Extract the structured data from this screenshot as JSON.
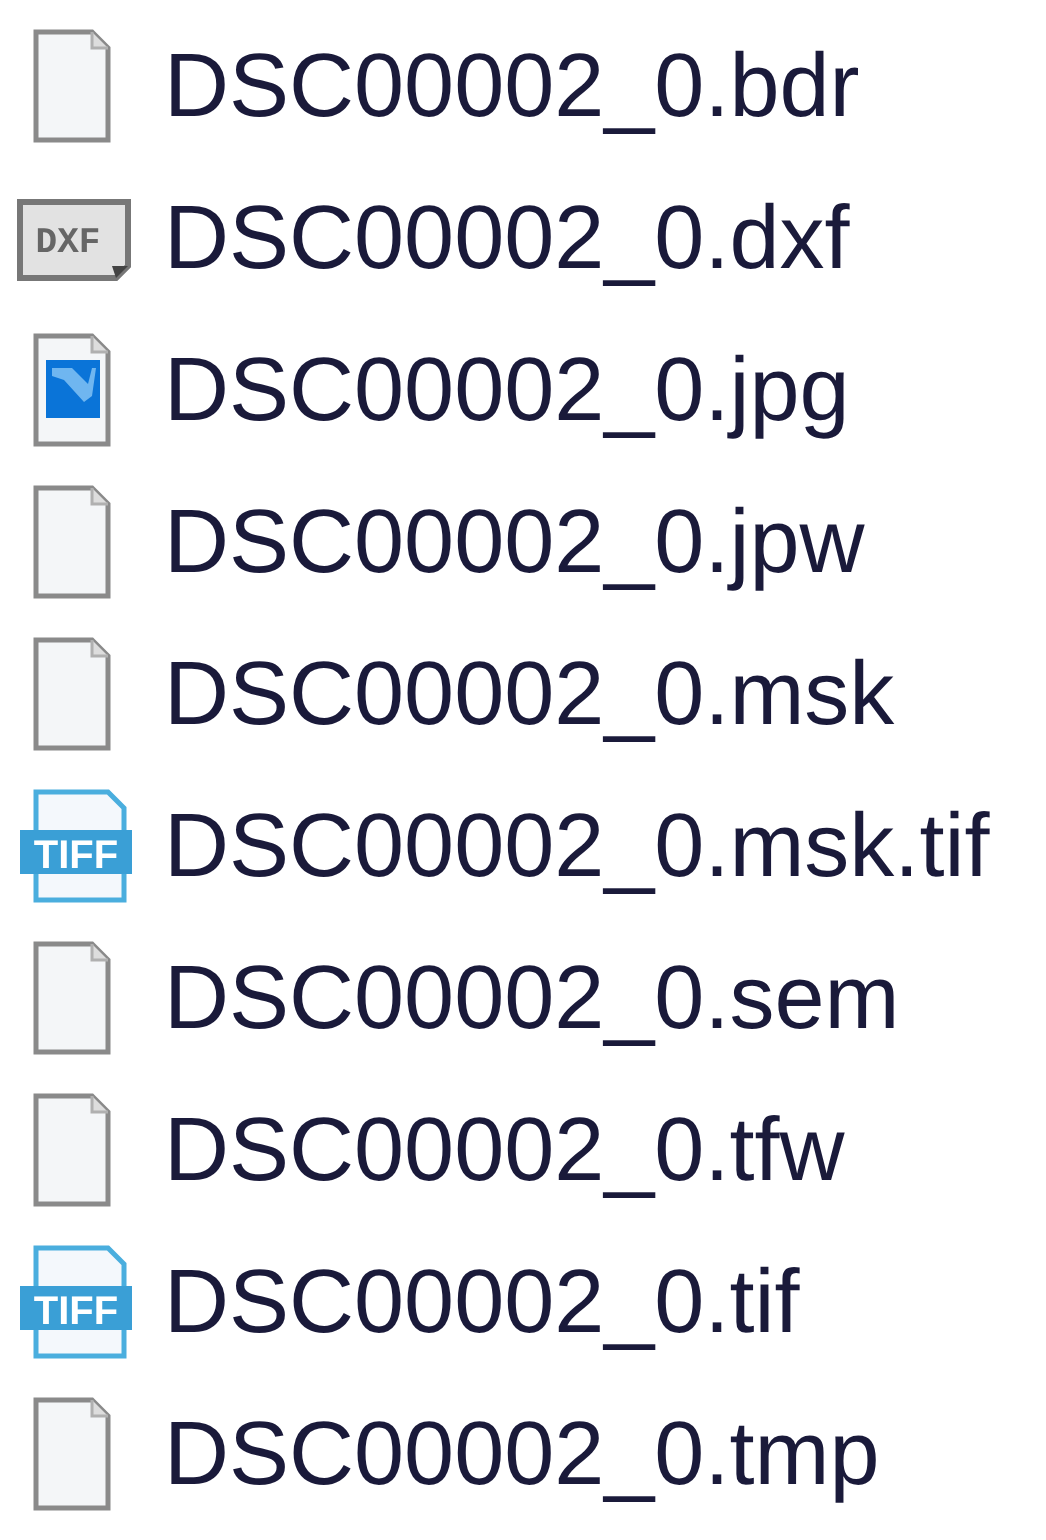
{
  "files": [
    {
      "name": "DSC00002_0.bdr",
      "kind": "blank"
    },
    {
      "name": "DSC00002_0.dxf",
      "kind": "dxf",
      "icon_label": "DXF"
    },
    {
      "name": "DSC00002_0.jpg",
      "kind": "image"
    },
    {
      "name": "DSC00002_0.jpw",
      "kind": "blank"
    },
    {
      "name": "DSC00002_0.msk",
      "kind": "blank"
    },
    {
      "name": "DSC00002_0.msk.tif",
      "kind": "tiff",
      "icon_label": "TIFF"
    },
    {
      "name": "DSC00002_0.sem",
      "kind": "blank"
    },
    {
      "name": "DSC00002_0.tfw",
      "kind": "blank"
    },
    {
      "name": "DSC00002_0.tif",
      "kind": "tiff",
      "icon_label": "TIFF"
    },
    {
      "name": "DSC00002_0.tmp",
      "kind": "blank"
    }
  ]
}
